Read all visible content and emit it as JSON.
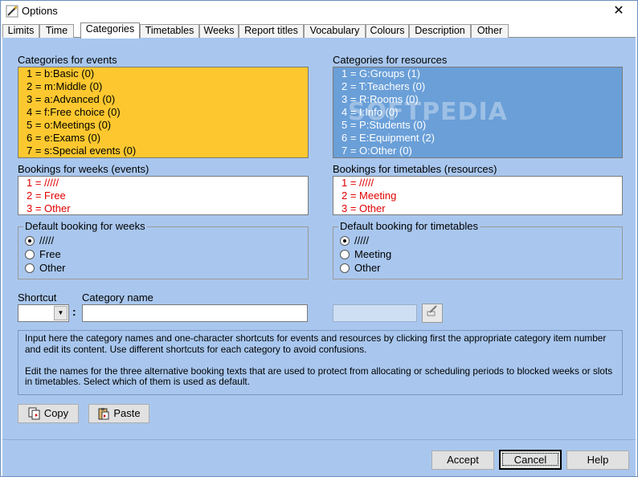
{
  "window": {
    "title": "Options",
    "close_glyph": "✕"
  },
  "tabs": [
    {
      "label": "Limits"
    },
    {
      "label": "Time"
    },
    {
      "label": "Categories"
    },
    {
      "label": "Timetables"
    },
    {
      "label": "Weeks"
    },
    {
      "label": "Report titles"
    },
    {
      "label": "Vocabulary"
    },
    {
      "label": "Colours"
    },
    {
      "label": "Description"
    },
    {
      "label": "Other"
    }
  ],
  "active_tab": "Categories",
  "events": {
    "title": "Categories for events",
    "items": [
      "1 = b:Basic  (0)",
      "2 = m:Middle  (0)",
      "3 = a:Advanced  (0)",
      "4 = f:Free choice  (0)",
      "5 = o:Meetings  (0)",
      "6 = e:Exams  (0)",
      "7 = s:Special events  (0)"
    ],
    "color": "#fdc82f"
  },
  "resources": {
    "title": "Categories for resources",
    "items": [
      "1 = G:Groups  (1)",
      "2 = T:Teachers  (0)",
      "3 = R:Rooms  (0)",
      "4 = I:Info  (0)",
      "5 = P:Students  (0)",
      "6 = E:Equipment  (2)",
      "7 = O:Other  (0)"
    ],
    "color": "#6a9fd8"
  },
  "bookings_weeks": {
    "title": "Bookings for weeks (events)",
    "items": [
      "1 = /////",
      "2 = Free",
      "3 = Other"
    ]
  },
  "bookings_timetables": {
    "title": "Bookings for timetables (resources)",
    "items": [
      "1 = /////",
      "2 = Meeting",
      "3 = Other"
    ]
  },
  "default_weeks": {
    "title": "Default booking for weeks",
    "options": [
      "/////",
      "Free",
      "Other"
    ],
    "selected": "/////"
  },
  "default_timetables": {
    "title": "Default booking for timetables",
    "options": [
      "/////",
      "Meeting",
      "Other"
    ],
    "selected": "/////"
  },
  "editor": {
    "shortcut_label": "Shortcut",
    "category_label": "Category name",
    "shortcut_value": "",
    "category_value": "",
    "separator": ":"
  },
  "info": {
    "paragraph1": "Input here the category names and one-character shortcuts for events and resources by clicking first the appropriate category item number and edit its content. Use different shortcuts for each category to avoid confusions.",
    "paragraph2": "Edit the names for the three alternative booking texts that are used to protect from allocating or scheduling periods to blocked weeks or slots in timetables. Select which of them is used as default."
  },
  "buttons": {
    "copy": "Copy",
    "paste": "Paste",
    "accept": "Accept",
    "cancel": "Cancel",
    "help": "Help"
  },
  "watermark": "SOFTPEDIA"
}
